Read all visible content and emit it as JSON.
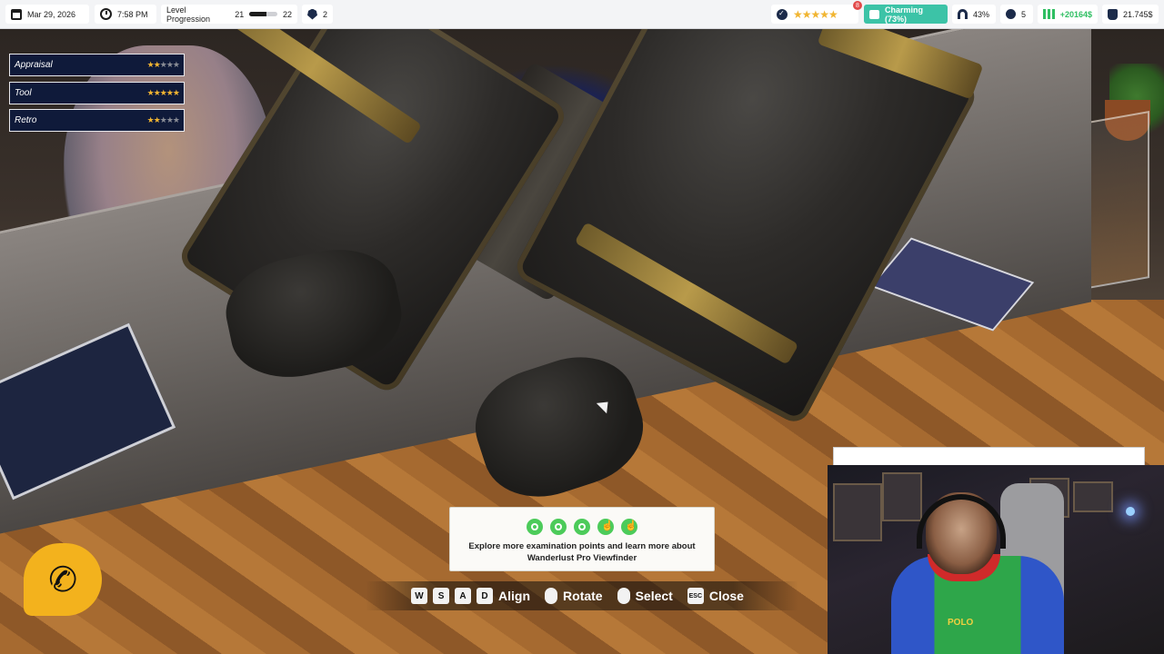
{
  "topbar": {
    "date": "Mar 29, 2026",
    "time": "7:58 PM",
    "level_label": "Level Progression",
    "level_current": "21",
    "level_next": "22",
    "level_progress": 0.6,
    "badges": "2",
    "rating_stars_filled": 5,
    "notification_count": "8",
    "store_mood": "Charming (73%)",
    "magnet_percent": "43%",
    "orb_count": "5",
    "profit_delta": "+20164$",
    "balance": "21.745$"
  },
  "tags": [
    {
      "label": "Appraisal",
      "stars": 2
    },
    {
      "label": "Tool",
      "stars": 5
    },
    {
      "label": "Retro",
      "stars": 2
    }
  ],
  "examination": {
    "points_total": 5,
    "points_found": 3,
    "line1": "Explore more examination points and learn more about",
    "line2": "Wanderlust Pro Viewfinder"
  },
  "controls": {
    "keys": [
      "W",
      "S",
      "A",
      "D"
    ],
    "align": "Align",
    "rotate": "Rotate",
    "select": "Select",
    "esc_key": "ESC",
    "close": "Close"
  },
  "webcam": {
    "hoodie_text": "POLO"
  },
  "colors": {
    "accent_mood": "#3cc3a7",
    "star": "#f1b531",
    "profit": "#2fbf62",
    "phone": "#f3b21d",
    "tag_bg": "#0f1a3a"
  },
  "icons": {
    "phone": "phone-icon",
    "calendar": "calendar-icon",
    "clock": "clock-icon"
  }
}
